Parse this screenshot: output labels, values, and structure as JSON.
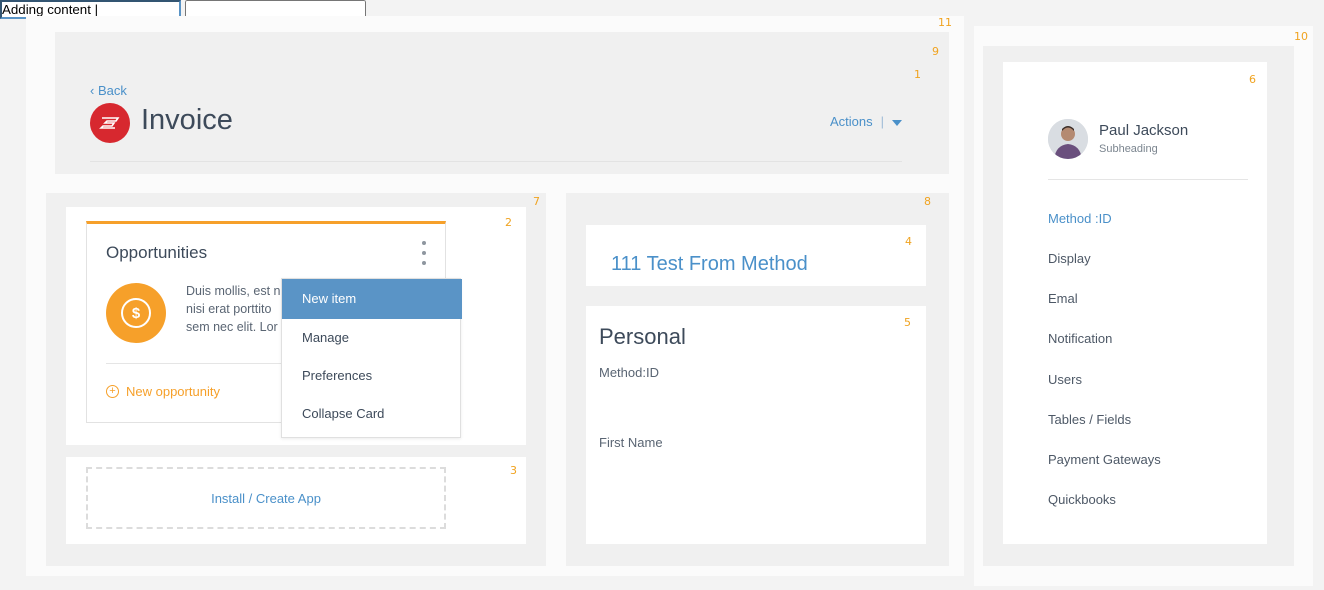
{
  "numbers": [
    "11",
    "9",
    "1",
    "10",
    "6",
    "7",
    "2",
    "8",
    "4",
    "5",
    "3"
  ],
  "header": {
    "back_label": "Back",
    "title": "Invoice",
    "actions_label": "Actions",
    "actions_separator": "|"
  },
  "opportunities": {
    "title": "Opportunities",
    "coin_symbol": "$",
    "description": "Duis mollis, est n nisi erat porttito sem nec elit. Lor",
    "new_label": "New opportunity"
  },
  "menu": {
    "items": [
      "New item",
      "Manage",
      "Preferences",
      "Collapse Card"
    ],
    "active_index": 0
  },
  "install": {
    "label": "Install / Create App"
  },
  "method": {
    "title": "111 Test From Method"
  },
  "personal": {
    "title": "Personal",
    "fields": [
      {
        "label": "Method:ID",
        "value": "Adding content |"
      },
      {
        "label": "First Name",
        "value": ""
      }
    ]
  },
  "profile": {
    "name": "Paul Jackson",
    "subheading": "Subheading",
    "nav": [
      "Method :ID",
      "Display",
      "Emal",
      "Notification",
      "Users",
      "Tables / Fields",
      "Payment Gateways",
      "Quickbooks"
    ],
    "active_index": 0
  },
  "colors": {
    "accent_blue": "#4a90c9",
    "accent_orange": "#f6a02a",
    "brand_red": "#d7282f",
    "menu_active": "#5a94c6"
  }
}
